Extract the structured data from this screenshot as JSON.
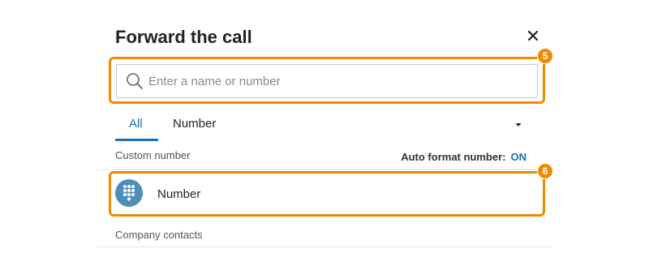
{
  "dialog": {
    "title": "Forward the call",
    "close_icon": "close-icon"
  },
  "search": {
    "placeholder": "Enter a name or number",
    "value": "",
    "icon": "search-icon"
  },
  "tabs": [
    {
      "label": "All",
      "active": true
    },
    {
      "label": "Number",
      "active": false
    }
  ],
  "dropdown_icon": "caret-down-icon",
  "sections": {
    "custom_number": "Custom number",
    "company_contacts": "Company contacts"
  },
  "auto_format": {
    "label": "Auto format number:",
    "value": "ON"
  },
  "custom_row": {
    "label": "Number",
    "icon": "dialpad-icon"
  },
  "callouts": [
    {
      "number": "5"
    },
    {
      "number": "6"
    }
  ],
  "colors": {
    "accent": "#1a6fb5",
    "callout": "#f08a00",
    "avatar": "#4e8fb8"
  }
}
